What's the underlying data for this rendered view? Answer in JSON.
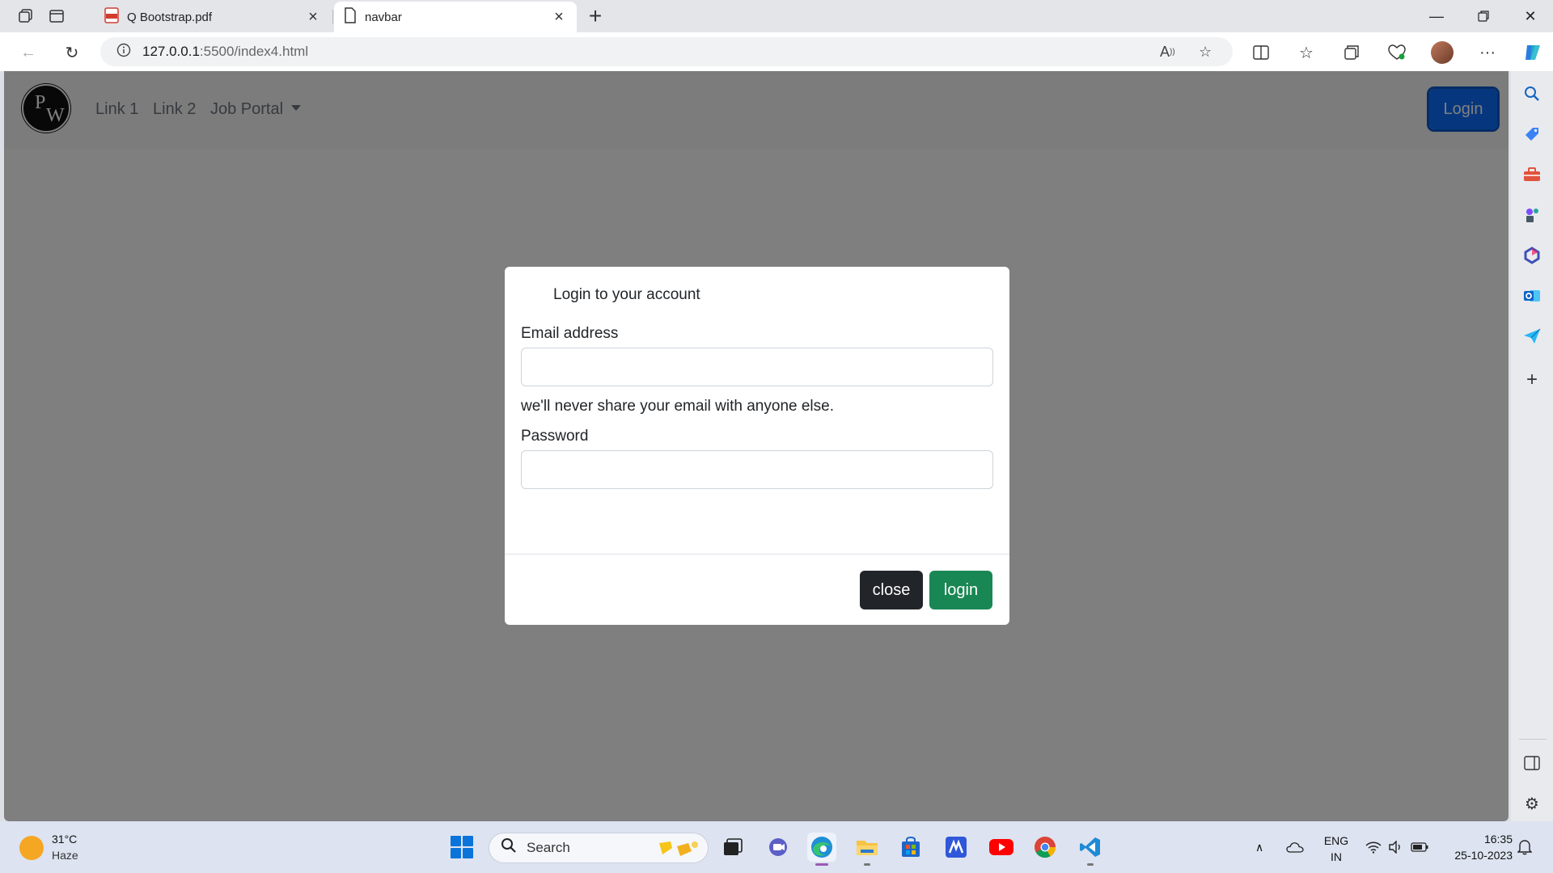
{
  "browser": {
    "tabs": [
      {
        "title": "Q Bootstrap.pdf",
        "icon": "pdf-icon",
        "active": false
      },
      {
        "title": "navbar",
        "icon": "page-icon",
        "active": true
      }
    ],
    "url_host": "127.0.0.1",
    "url_path": ":5500/index4.html"
  },
  "site": {
    "logo_text_1": "P",
    "logo_text_2": "W",
    "nav_links": [
      "Link 1",
      "Link 2",
      "Job Portal"
    ],
    "login_button": "Login"
  },
  "modal": {
    "title": "Login to your account",
    "email_label": "Email address",
    "email_value": "",
    "email_help": "we'll never share your email with anyone else.",
    "password_label": "Password",
    "password_value": "",
    "close_button": "close",
    "login_button": "login"
  },
  "taskbar": {
    "weather_temp": "31°C",
    "weather_condition": "Haze",
    "search_placeholder": "Search",
    "lang_line1": "ENG",
    "lang_line2": "IN",
    "time": "16:35",
    "date": "25-10-2023"
  },
  "colors": {
    "primary": "#0d6efd",
    "success": "#198754",
    "dark": "#212529"
  }
}
